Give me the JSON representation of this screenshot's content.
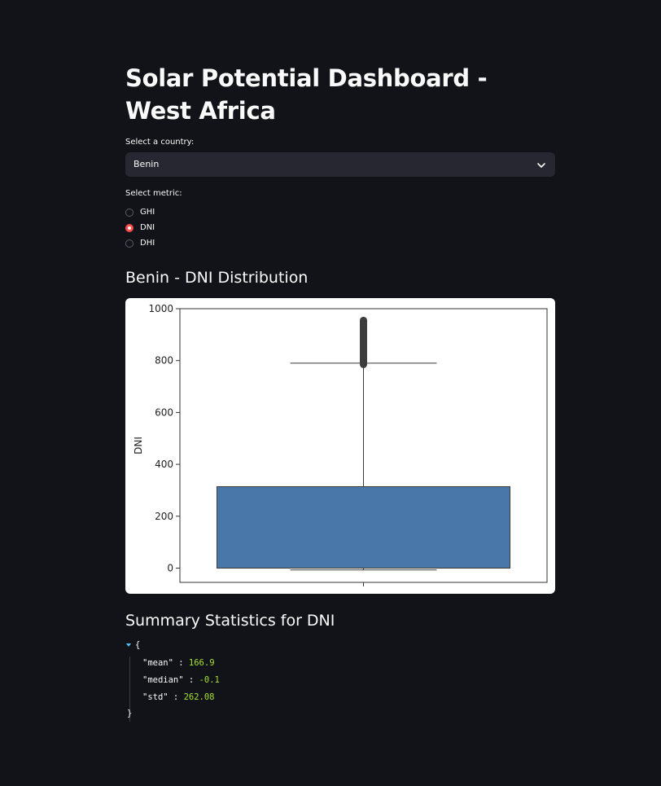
{
  "page": {
    "title": "Solar Potential Dashboard - West Africa"
  },
  "country_select": {
    "label": "Select a country:",
    "value": "Benin",
    "icon": "chevron-down-icon"
  },
  "metric_radio": {
    "label": "Select metric:",
    "options": [
      "GHI",
      "DNI",
      "DHI"
    ],
    "selected": "DNI"
  },
  "chart_section": {
    "heading": "Benin - DNI Distribution"
  },
  "chart_data": {
    "type": "box",
    "ylabel": "DNI",
    "xlabel": "",
    "ylim": [
      -55,
      1000
    ],
    "yticks": [
      0,
      200,
      400,
      600,
      800,
      1000
    ],
    "ytick_labels": [
      "0",
      "200",
      "400",
      "600",
      "800",
      "1000"
    ],
    "series": [
      {
        "q1": 0,
        "median": -0.1,
        "q3": 314,
        "whisker_low": -7,
        "whisker_high": 790,
        "outliers_min": 785,
        "outliers_max": 955,
        "color": "#4a77aa"
      }
    ],
    "grid": false
  },
  "stats_section": {
    "heading": "Summary Statistics for DNI",
    "open_brace": "{",
    "close_brace": "}",
    "entries": [
      {
        "key": "\"mean\"",
        "sep": " : ",
        "value": "166.9"
      },
      {
        "key": "\"median\"",
        "sep": " : ",
        "value": "-0.1"
      },
      {
        "key": "\"std\"",
        "sep": " : ",
        "value": "262.08"
      }
    ]
  },
  "colors": {
    "background": "#111318",
    "accent": "#ff4b4b",
    "select_bg": "#262730",
    "json_value": "#a6e22e",
    "box_fill": "#4a77aa"
  }
}
